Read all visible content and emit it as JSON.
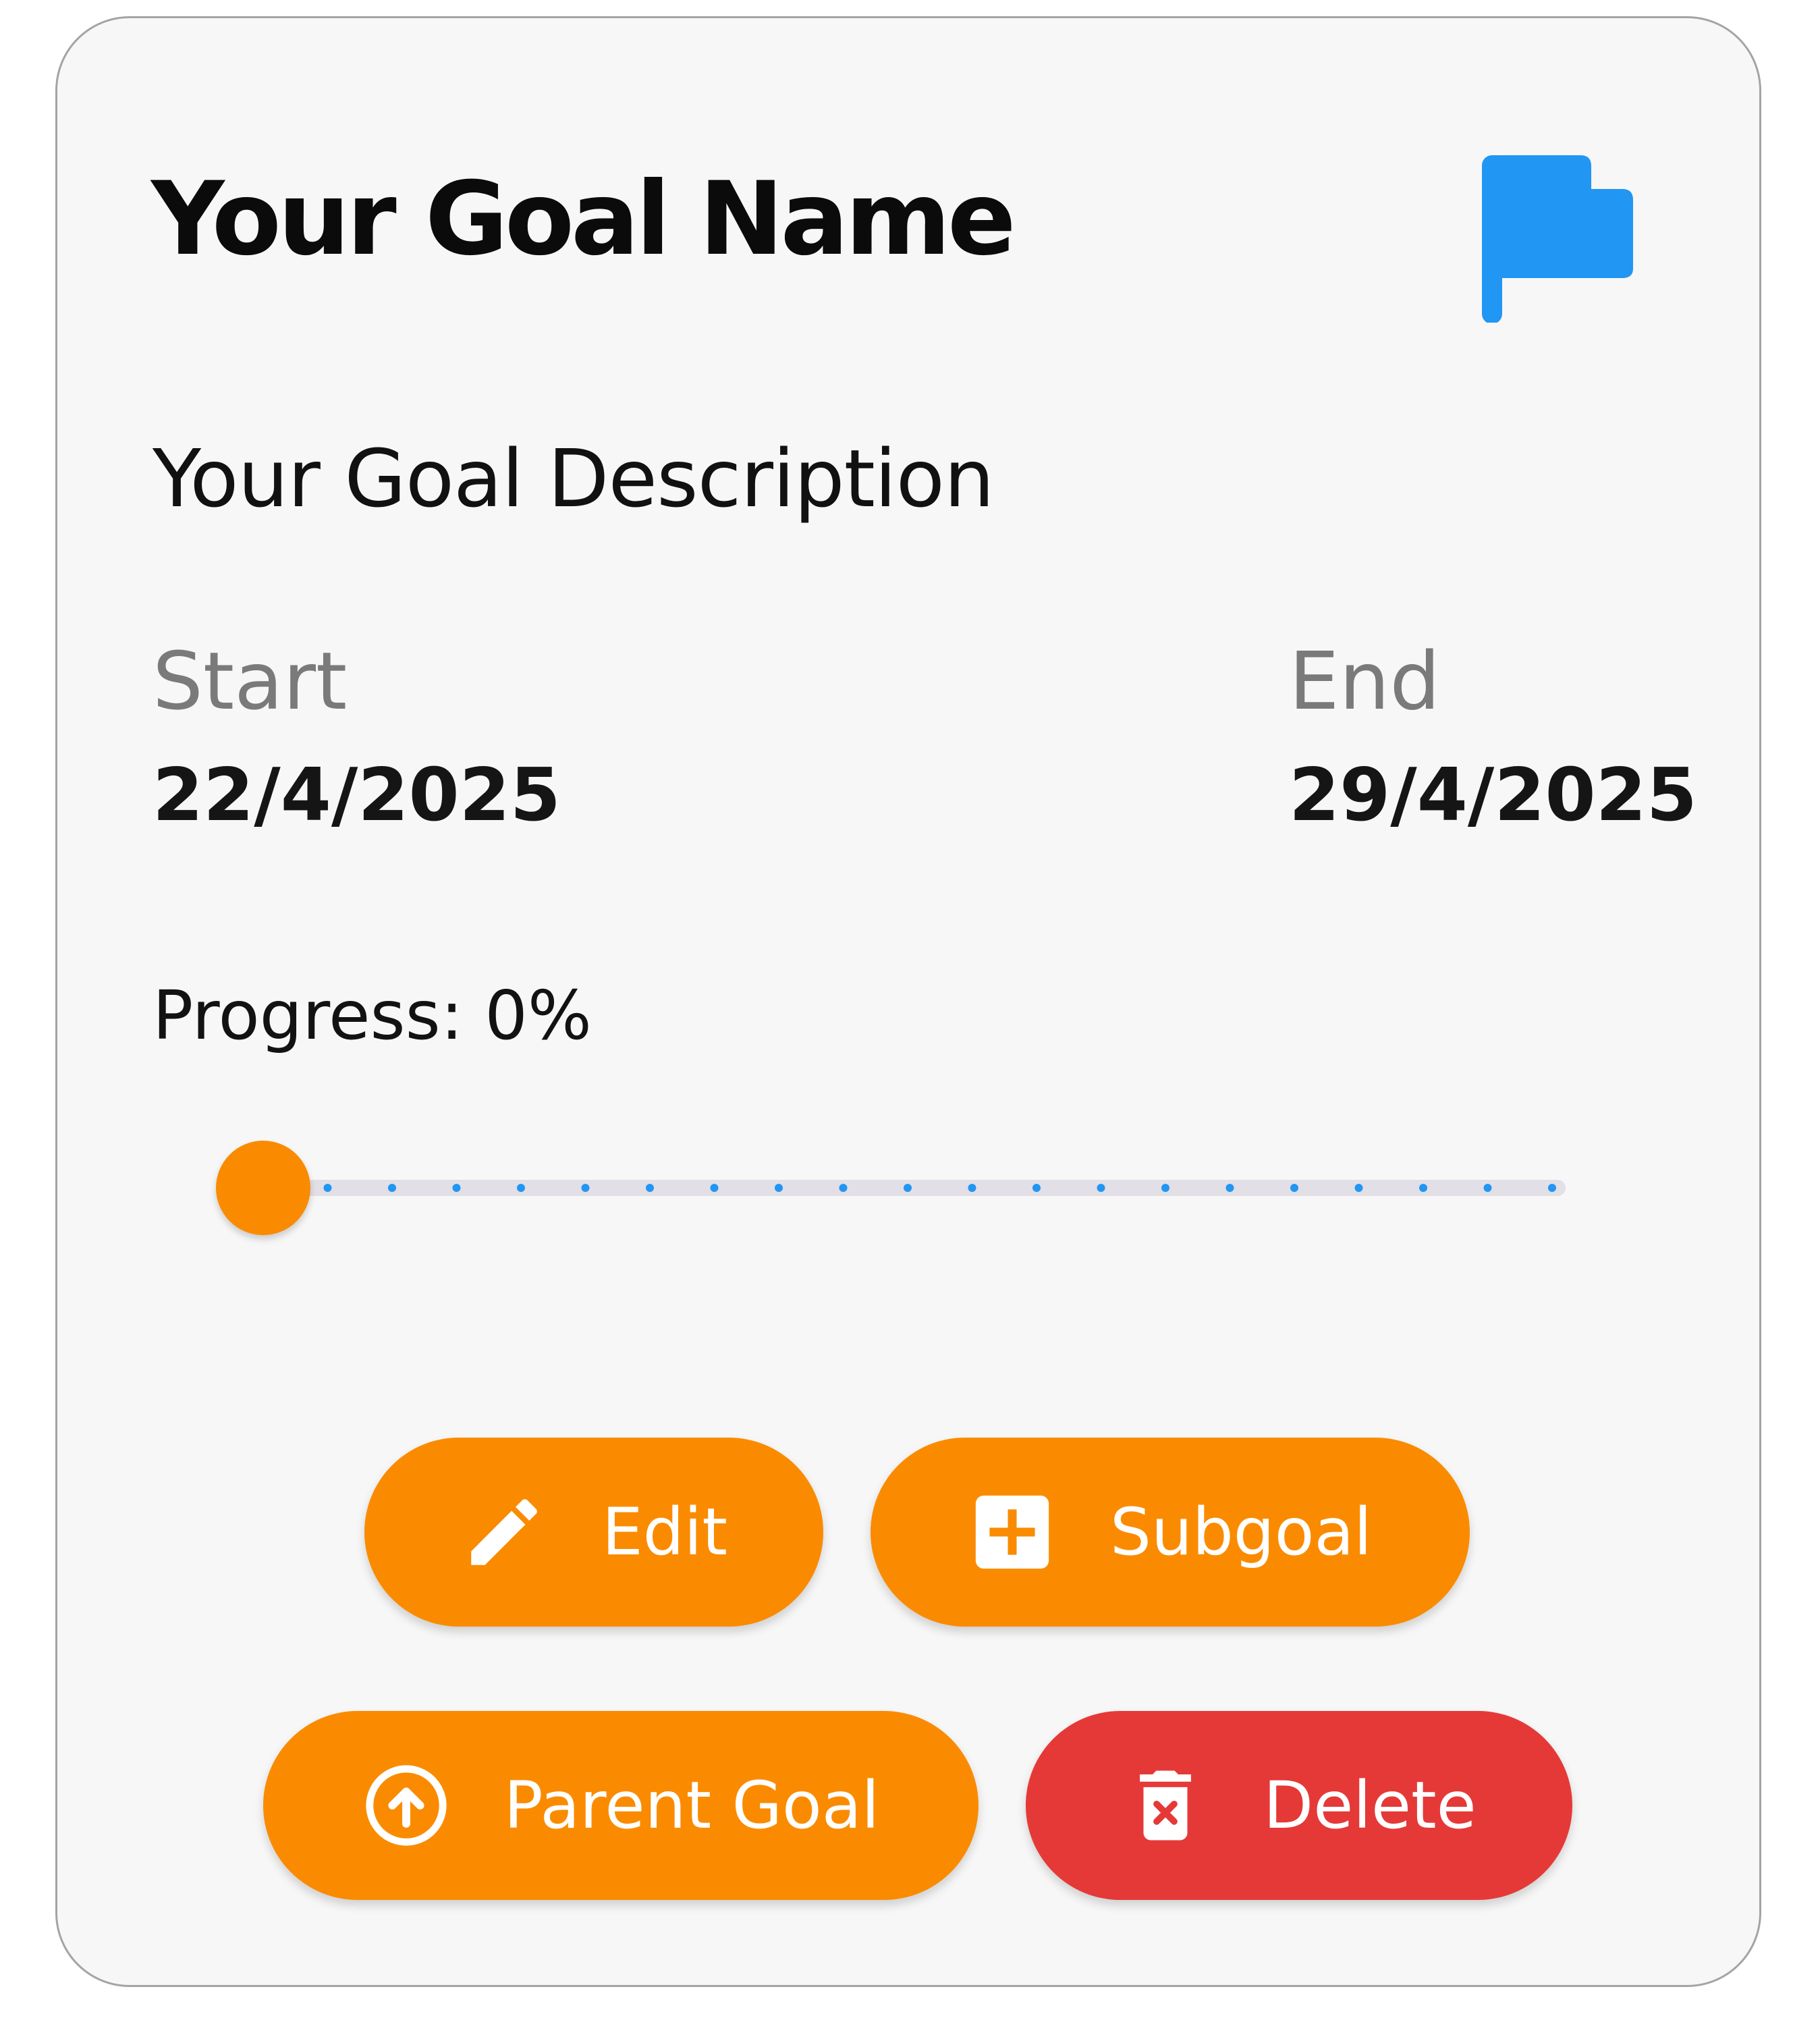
{
  "goal": {
    "name": "Your Goal Name",
    "description": "Your Goal Description",
    "flag_icon": "flag-icon",
    "flag_color": "#2196f3"
  },
  "dates": {
    "start_label": "Start",
    "start_value": "22/4/2025",
    "end_label": "End",
    "end_value": "29/4/2025"
  },
  "progress": {
    "label": "Progress: 0%",
    "value": 0,
    "max": 100,
    "divisions": 20,
    "thumb_color": "#fa8b00",
    "track_color": "#e2dfe7",
    "tick_color": "#2196f3"
  },
  "actions": {
    "edit": {
      "label": "Edit",
      "icon": "pencil-icon",
      "color": "#fa8b00"
    },
    "subgoal": {
      "label": "Subgoal",
      "icon": "add-box-icon",
      "color": "#fa8b00"
    },
    "parent_goal": {
      "label": "Parent Goal",
      "icon": "arrow-up-circle-icon",
      "color": "#fa8b00"
    },
    "delete": {
      "label": "Delete",
      "icon": "trash-icon",
      "color": "#e53938"
    }
  }
}
